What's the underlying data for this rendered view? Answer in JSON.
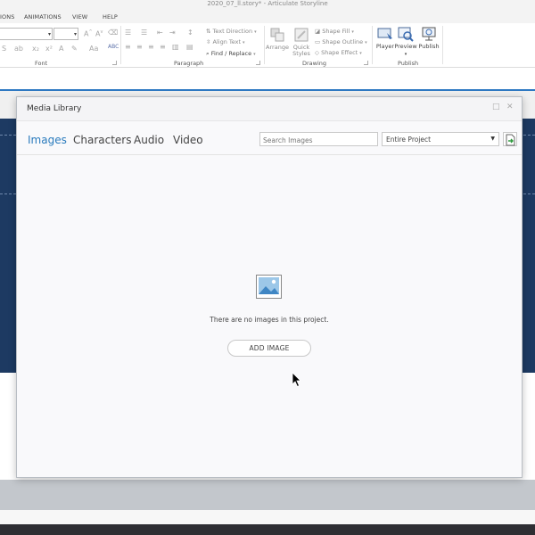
{
  "window": {
    "title": "2020_07_ll.story* - Articulate Storyline"
  },
  "menu_tabs": [
    "IONS",
    "ANIMATIONS",
    "VIEW",
    "HELP"
  ],
  "ribbon": {
    "groups": {
      "font": "Font",
      "paragraph": "Paragraph",
      "drawing": "Drawing",
      "publish": "Publish"
    },
    "paragraph": {
      "text_direction": "Text Direction",
      "align_text": "Align Text",
      "find_replace": "Find / Replace"
    },
    "drawing": {
      "arrange": "Arrange",
      "quick_styles": "Quick Styles",
      "shape_fill": "Shape Fill",
      "shape_outline": "Shape Outline",
      "shape_effect": "Shape Effect"
    },
    "publish": {
      "player": "Player",
      "preview": "Preview",
      "publish": "Publish"
    }
  },
  "dialog": {
    "title": "Media Library",
    "tabs": [
      {
        "label": "Images",
        "active": true
      },
      {
        "label": "Characters",
        "active": false
      },
      {
        "label": "Audio",
        "active": false
      },
      {
        "label": "Video",
        "active": false
      }
    ],
    "search": {
      "placeholder": "Search Images",
      "value": ""
    },
    "scope": {
      "selected": "Entire Project"
    },
    "empty_message": "There are no images in this project.",
    "add_image_label": "ADD IMAGE"
  },
  "colors": {
    "accent": "#2a7bbd",
    "slide_navy": "#1d3a62",
    "ribbon_accent_line": "#2f79c2"
  }
}
